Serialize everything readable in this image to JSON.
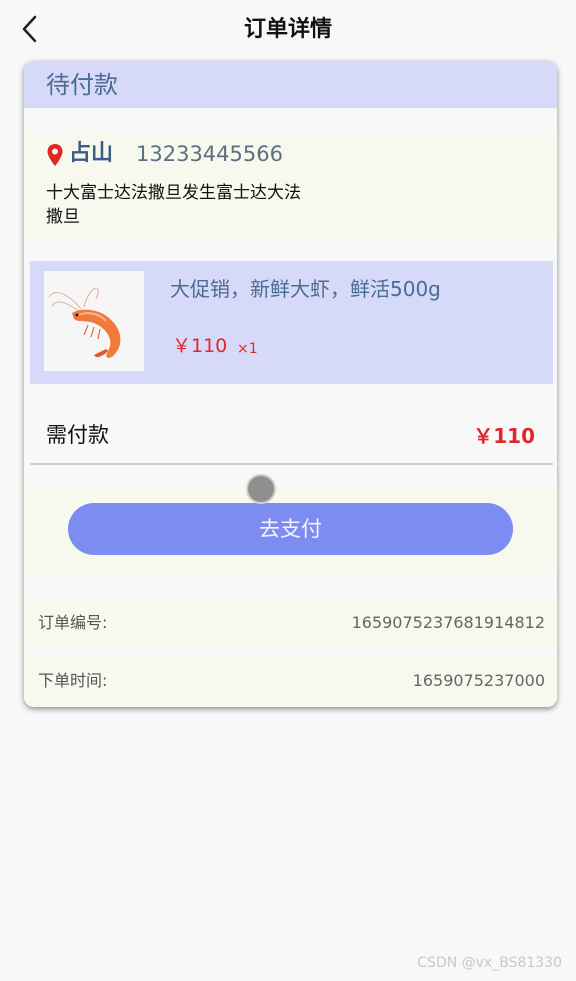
{
  "header": {
    "title": "订单详情",
    "back_icon": "chevron-left-icon"
  },
  "order": {
    "status": "待付款",
    "receiver": {
      "name": "占山",
      "phone": "13233445566",
      "address": "十大富士达法撒旦发生富士达大法撒旦",
      "pin_icon": "location-pin-icon",
      "pin_color": "#e22626"
    },
    "product": {
      "name": "大促销，新鲜大虾，鲜活500g",
      "price": "￥110",
      "qty": "×1",
      "image_icon": "shrimp-image"
    },
    "payable": {
      "label": "需付款",
      "amount": "￥110"
    },
    "pay_button_label": "去支付",
    "info": {
      "order_no_label": "订单编号:",
      "order_no": "1659075237681914812",
      "order_time_label": "下单时间:",
      "order_time": "1659075237000"
    }
  },
  "colors": {
    "accent": "#7d8cf0",
    "status_bg": "#d6d9f7",
    "price": "#e2262e",
    "section_bg": "#f7f8ee"
  },
  "watermark": "CSDN @vx_BS81330"
}
